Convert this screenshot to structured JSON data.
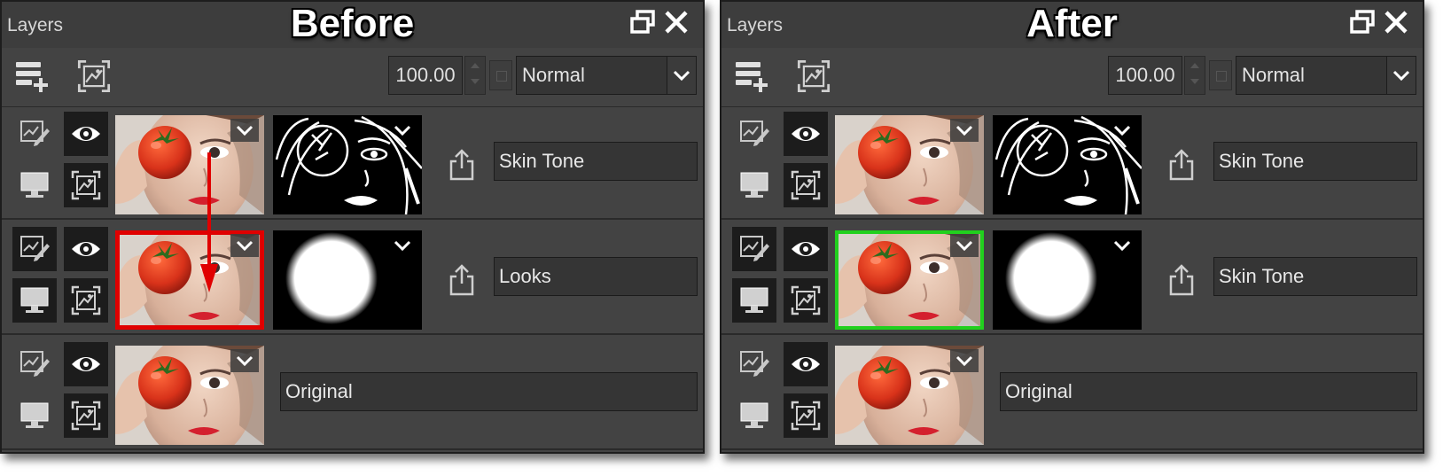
{
  "panels": [
    {
      "id": "before",
      "header_label": "Layers",
      "caption": "Before",
      "opacity": "100.00",
      "blend_mode": "Normal",
      "layers": [
        {
          "name": "Skin Tone",
          "has_mask": true,
          "mask": "edges"
        },
        {
          "name": "Looks",
          "has_mask": true,
          "mask": "circle",
          "selected": true,
          "selection_color": "#e00000"
        },
        {
          "name": "Original",
          "has_mask": false
        }
      ]
    },
    {
      "id": "after",
      "header_label": "Layers",
      "caption": "After",
      "opacity": "100.00",
      "blend_mode": "Normal",
      "layers": [
        {
          "name": "Skin Tone",
          "has_mask": true,
          "mask": "edges"
        },
        {
          "name": "Skin Tone",
          "has_mask": true,
          "mask": "circle",
          "selected": true,
          "selection_color": "#21d01e"
        },
        {
          "name": "Original",
          "has_mask": false
        }
      ]
    }
  ],
  "colors": {
    "panel_bg": "#434343",
    "titlebar_bg": "#3d3d3d",
    "button_active": "#1c1c1c",
    "arrow": "#e00000"
  }
}
